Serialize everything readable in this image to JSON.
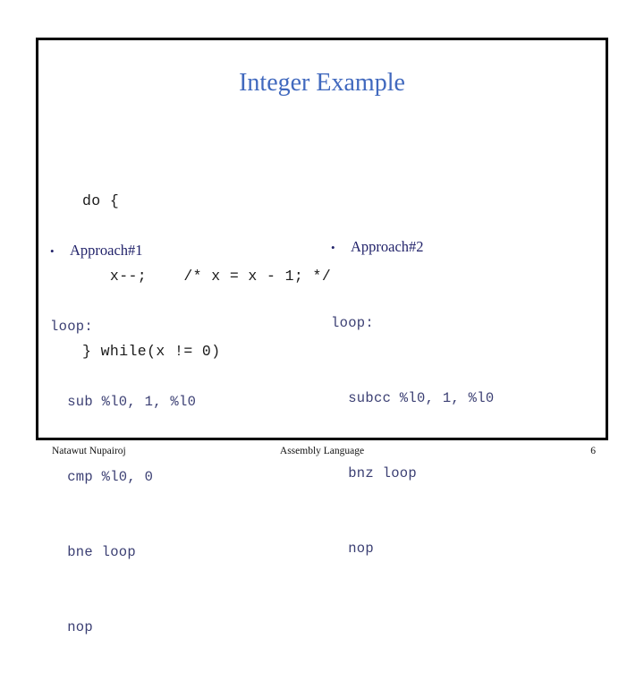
{
  "slide": {
    "title": "Integer Example",
    "accent_color": "#4169BE",
    "code_color": "#1a1a1a",
    "asm_color": "#3b3f73",
    "heading_color": "#23246b",
    "border_color": "#000000",
    "background_color": "#ffffff"
  },
  "c_code": {
    "language": "C",
    "lines": [
      "do {",
      "   x--;    /* x = x - 1; */",
      "} while(x != 0)"
    ]
  },
  "approaches": [
    {
      "bullet": "•",
      "label": "Approach#1",
      "lines": [
        "loop:",
        "  sub %l0, 1, %l0",
        "  cmp %l0, 0",
        "  bne loop",
        "  nop"
      ]
    },
    {
      "bullet": "•",
      "label": "Approach#2",
      "lines": [
        "loop:",
        "  subcc %l0, 1, %l0",
        "  bnz loop",
        "  nop"
      ]
    }
  ],
  "footer": {
    "author": "Natawut Nupairoj",
    "subject": "Assembly Language",
    "page_number": "6"
  }
}
